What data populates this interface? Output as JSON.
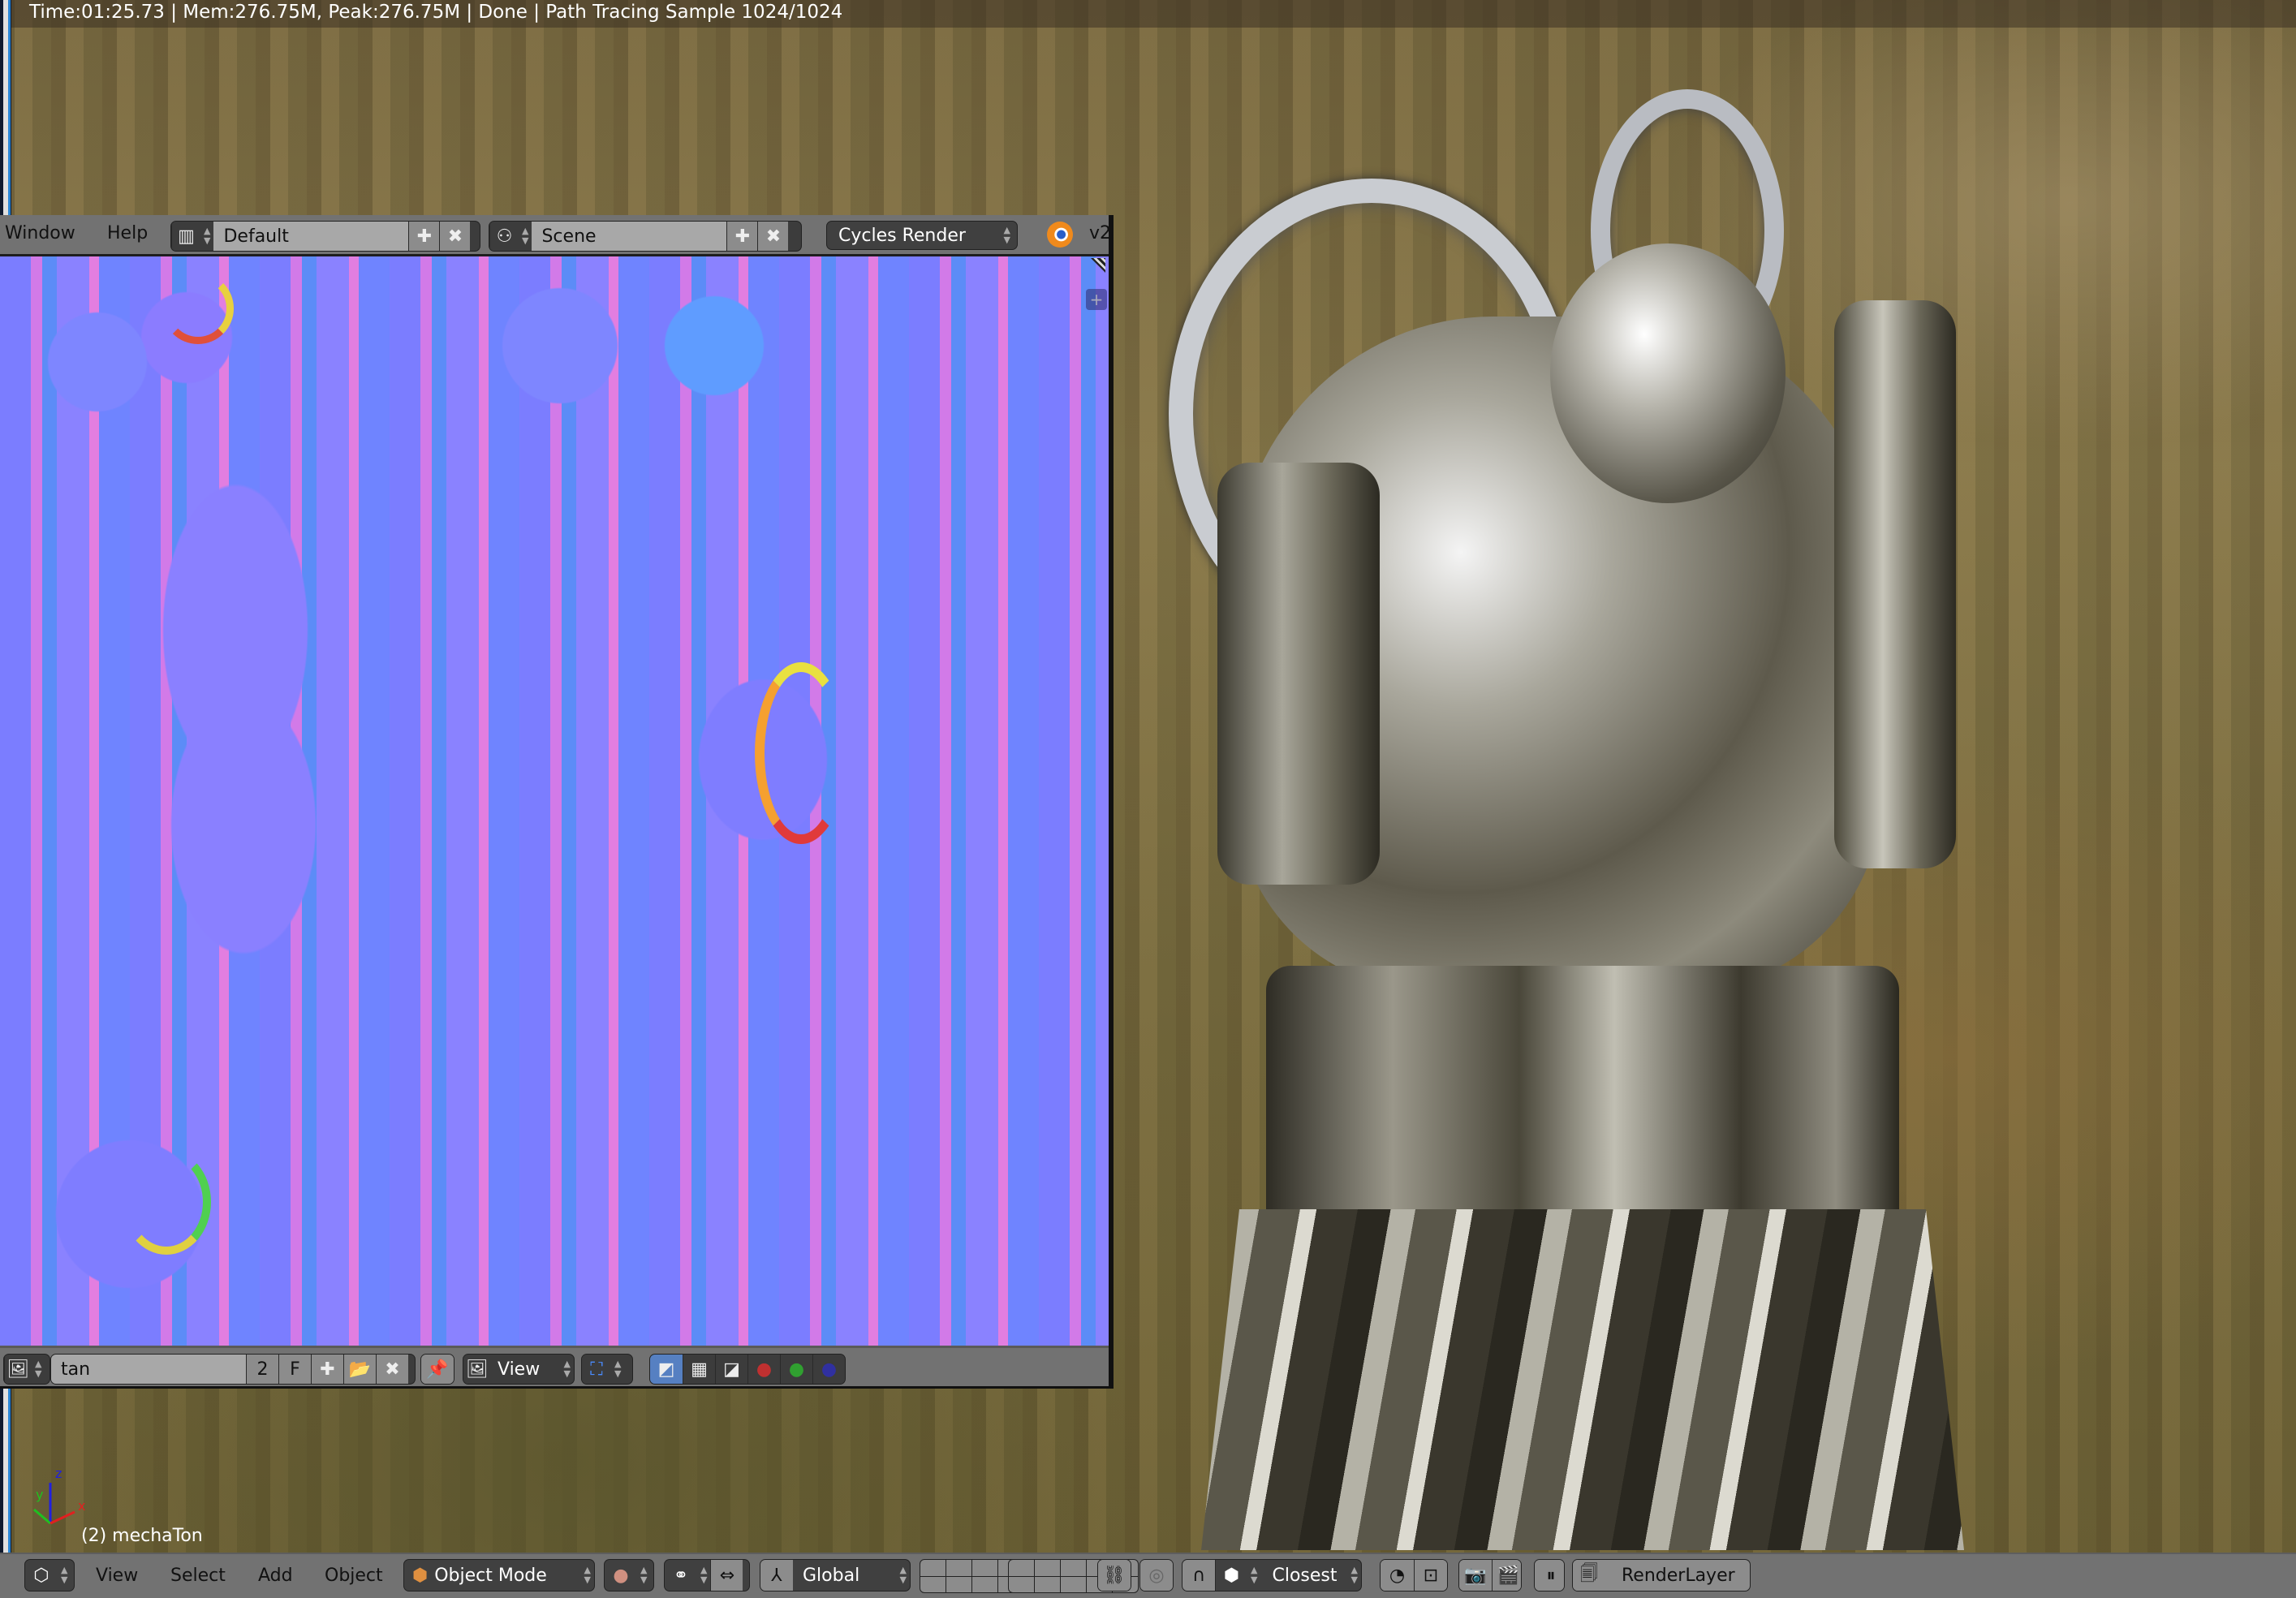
{
  "render_status": "Time:01:25.73 | Mem:276.75M, Peak:276.75M | Done | Path Tracing Sample 1024/1024",
  "info_header": {
    "menu": [
      "Window",
      "Help"
    ],
    "screen_layout": {
      "icon": "screen-layout-icon",
      "value": "Default"
    },
    "scene": {
      "icon": "scene-icon",
      "value": "Scene"
    },
    "render_engine": "Cycles Render",
    "version_label": "v2",
    "blender_logo": "blender-logo-icon"
  },
  "image_editor": {
    "image_name": "tan",
    "user_count": "2",
    "fake_user": "F",
    "view_menu": "View",
    "display_channels": [
      "color-alpha",
      "color",
      "alpha",
      "red",
      "green",
      "blue"
    ],
    "selected_channel": "color-alpha"
  },
  "viewport": {
    "object_info": "(2) mechaTon",
    "axes": {
      "x": "x",
      "y": "y",
      "z": "z"
    },
    "axis_colors": {
      "x": "#e02020",
      "y": "#20c020",
      "z": "#2020e0"
    }
  },
  "view3d_header": {
    "menu": [
      "View",
      "Select",
      "Add",
      "Object"
    ],
    "mode": "Object Mode",
    "transform_orientation": "Global",
    "snap_element": "Closest",
    "render_layer": "RenderLayer"
  },
  "colors": {
    "ui_gray": "#727272",
    "field_gray": "#a8a8a8",
    "dark_widget": "#404040",
    "selected_blue": "#5680c2"
  }
}
